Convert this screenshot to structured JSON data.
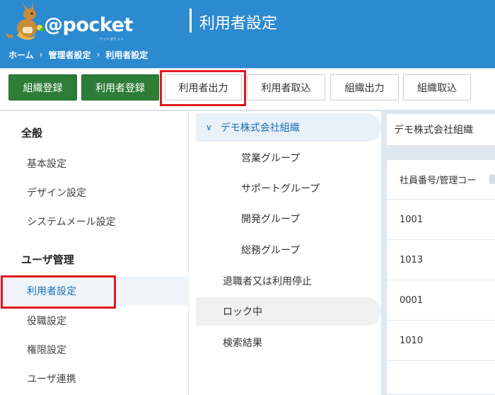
{
  "header": {
    "logo_text": "@pocket",
    "logo_subtext": "アットポケット",
    "page_title": "利用者設定",
    "breadcrumb": [
      "ホーム",
      "管理者設定",
      "利用者設定"
    ],
    "breadcrumb_separator": "›"
  },
  "toolbar": {
    "buttons": [
      {
        "label": "組織登録",
        "style": "green"
      },
      {
        "label": "利用者登録",
        "style": "green"
      },
      {
        "label": "利用者出力",
        "style": "white",
        "highlighted": true
      },
      {
        "label": "利用者取込",
        "style": "white"
      },
      {
        "label": "組織出力",
        "style": "white"
      },
      {
        "label": "組織取込",
        "style": "white"
      }
    ]
  },
  "sidebar": {
    "sections": [
      {
        "heading": "全般",
        "items": [
          "基本設定",
          "デザイン設定",
          "システムメール設定"
        ]
      },
      {
        "heading": "ユーザ管理",
        "items": [
          "利用者設定",
          "役職設定",
          "権限設定",
          "ユーザ連携"
        ]
      }
    ],
    "active_item": "利用者設定"
  },
  "tree": {
    "root": "デモ株式会社組織",
    "groups": [
      "営業グループ",
      "サポートグループ",
      "開発グループ",
      "総務グループ"
    ],
    "others": [
      "退職者又は利用停止",
      "ロック中",
      "検索結果"
    ]
  },
  "right_panel": {
    "org_name": "デモ株式会社組織",
    "table_header": "社員番号/管理コー",
    "rows": [
      "1001",
      "1013",
      "0001",
      "1010"
    ]
  },
  "colors": {
    "header_blue": "#2b8ad0",
    "green_button": "#2e7d36",
    "highlight_red": "#e0191e",
    "link_blue": "#1a6fb5"
  }
}
